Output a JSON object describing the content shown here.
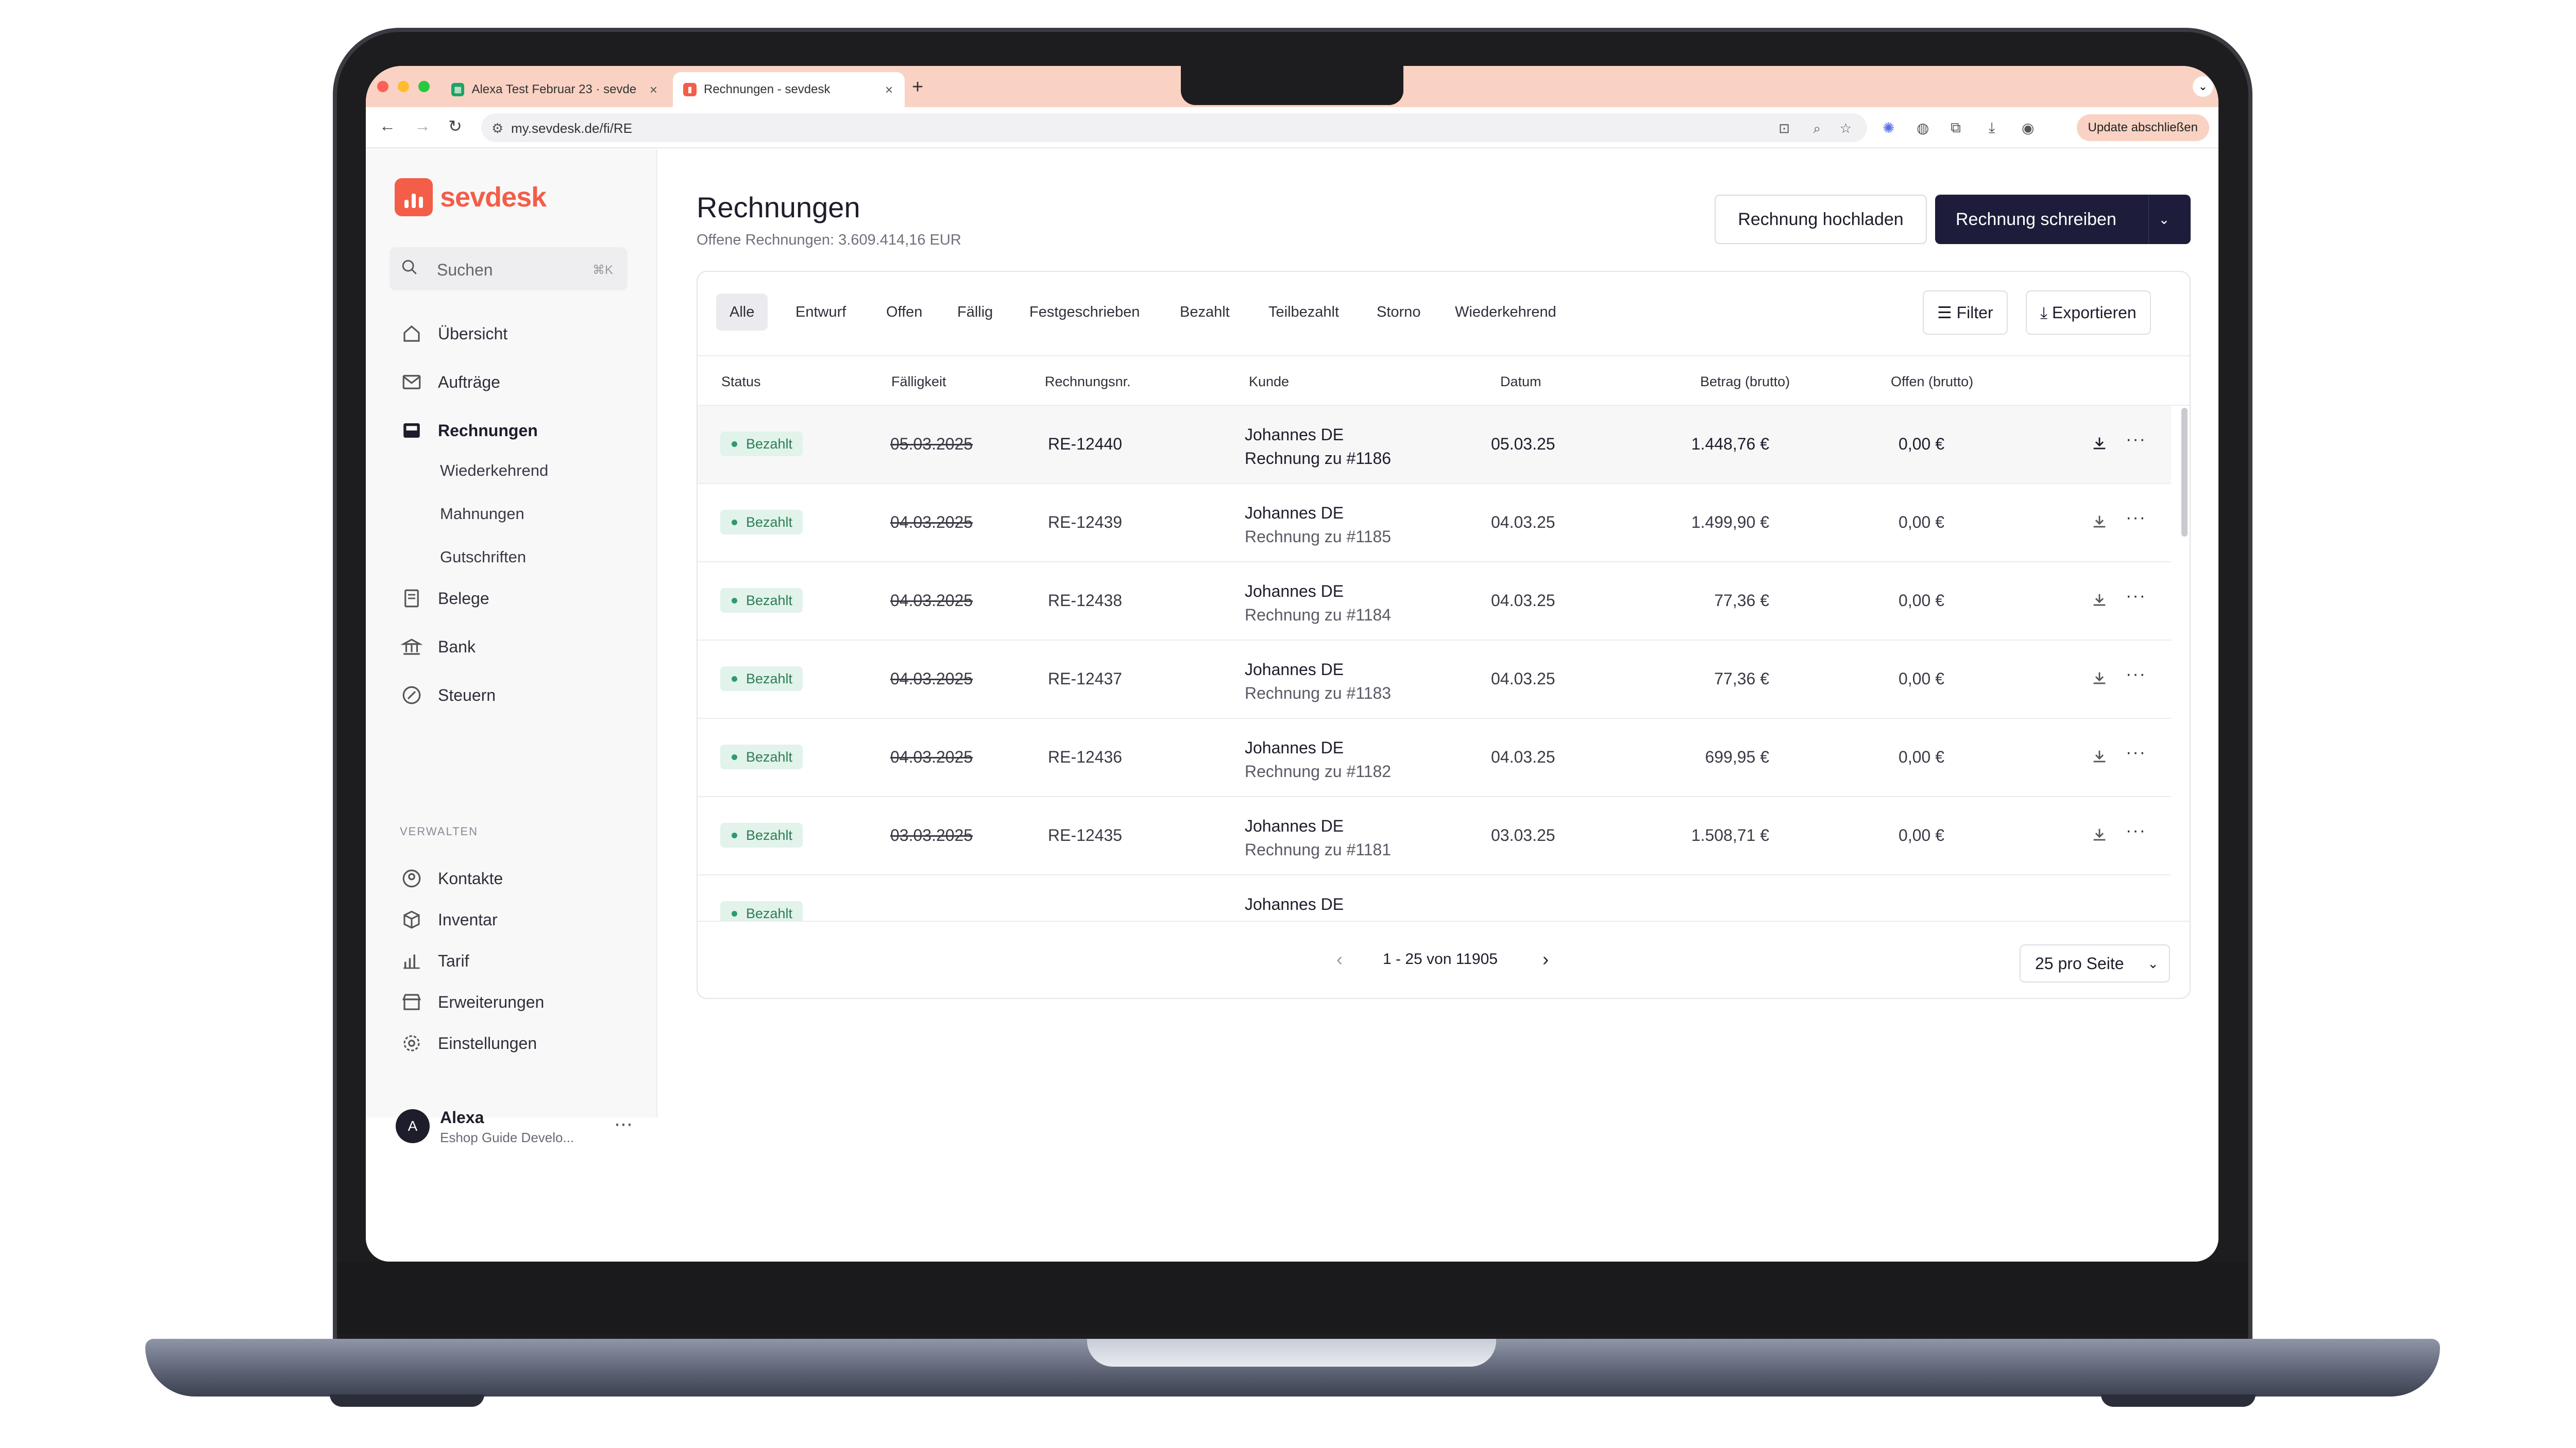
{
  "browser": {
    "tabs": [
      {
        "title": "Alexa Test Februar 23 · sevde",
        "favicon": "sheet-icon"
      },
      {
        "title": "Rechnungen - sevdesk",
        "favicon": "sevdesk-icon"
      }
    ],
    "new_tab": "+",
    "url": "my.sevdesk.de/fi/RE",
    "update_button": "Update abschließen"
  },
  "sidebar": {
    "logo_text": "sevdesk",
    "search_placeholder": "Suchen",
    "search_shortcut": "⌘K",
    "nav": [
      {
        "label": "Übersicht",
        "icon": "home-icon"
      },
      {
        "label": "Aufträge",
        "icon": "mail-icon"
      },
      {
        "label": "Rechnungen",
        "icon": "inbox-icon",
        "active": true
      },
      {
        "label": "Belege",
        "icon": "receipt-icon"
      },
      {
        "label": "Bank",
        "icon": "bank-icon"
      },
      {
        "label": "Steuern",
        "icon": "percent-icon"
      }
    ],
    "sub_nav": [
      "Wiederkehrend",
      "Mahnungen",
      "Gutschriften"
    ],
    "section_label": "VERWALTEN",
    "manage": [
      {
        "label": "Kontakte",
        "icon": "contact-icon"
      },
      {
        "label": "Inventar",
        "icon": "box-icon"
      },
      {
        "label": "Tarif",
        "icon": "chart-icon"
      },
      {
        "label": "Erweiterungen",
        "icon": "store-icon"
      },
      {
        "label": "Einstellungen",
        "icon": "gear-icon"
      }
    ],
    "user": {
      "initial": "A",
      "name": "Alexa",
      "subtitle": "Eshop Guide Develo..."
    }
  },
  "main": {
    "title": "Rechnungen",
    "subtitle": "Offene Rechnungen: 3.609.414,16 EUR",
    "upload_button": "Rechnung hochladen",
    "write_button": "Rechnung schreiben",
    "filter_tabs": [
      "Alle",
      "Entwurf",
      "Offen",
      "Fällig",
      "Festgeschrieben",
      "Bezahlt",
      "Teilbezahlt",
      "Storno",
      "Wiederkehrend"
    ],
    "filter_button": "Filter",
    "export_button": "Exportieren",
    "columns": [
      "Status",
      "Fälligkeit",
      "Rechnungsnr.",
      "Kunde",
      "Datum",
      "Betrag (brutto)",
      "Offen (brutto)"
    ],
    "rows": [
      {
        "status": "Bezahlt",
        "due": "05.03.2025",
        "number": "RE-12440",
        "customer": "Johannes DE",
        "customer_sub": "Rechnung zu #1186",
        "date": "05.03.25",
        "amount": "1.448,76 €",
        "open": "0,00 €"
      },
      {
        "status": "Bezahlt",
        "due": "04.03.2025",
        "number": "RE-12439",
        "customer": "Johannes DE",
        "customer_sub": "Rechnung zu #1185",
        "date": "04.03.25",
        "amount": "1.499,90 €",
        "open": "0,00 €"
      },
      {
        "status": "Bezahlt",
        "due": "04.03.2025",
        "number": "RE-12438",
        "customer": "Johannes DE",
        "customer_sub": "Rechnung zu #1184",
        "date": "04.03.25",
        "amount": "77,36 €",
        "open": "0,00 €"
      },
      {
        "status": "Bezahlt",
        "due": "04.03.2025",
        "number": "RE-12437",
        "customer": "Johannes DE",
        "customer_sub": "Rechnung zu #1183",
        "date": "04.03.25",
        "amount": "77,36 €",
        "open": "0,00 €"
      },
      {
        "status": "Bezahlt",
        "due": "04.03.2025",
        "number": "RE-12436",
        "customer": "Johannes DE",
        "customer_sub": "Rechnung zu #1182",
        "date": "04.03.25",
        "amount": "699,95 €",
        "open": "0,00 €"
      },
      {
        "status": "Bezahlt",
        "due": "03.03.2025",
        "number": "RE-12435",
        "customer": "Johannes DE",
        "customer_sub": "Rechnung zu #1181",
        "date": "03.03.25",
        "amount": "1.508,71 €",
        "open": "0,00 €"
      },
      {
        "status": "Bezahlt",
        "due": "",
        "number": "",
        "customer": "Johannes DE",
        "customer_sub": "",
        "date": "",
        "amount": "",
        "open": ""
      }
    ],
    "pagination": {
      "text": "1 - 25 von 11905",
      "page_size": "25 pro Seite"
    }
  },
  "colors": {
    "brand": "#f45d48",
    "primary_button": "#1d1d3b",
    "paid_badge_bg": "#e1f3ea",
    "paid_badge_text": "#2e7d57",
    "tab_bar": "#f9d2c3",
    "help_button": "#4a42c8"
  }
}
